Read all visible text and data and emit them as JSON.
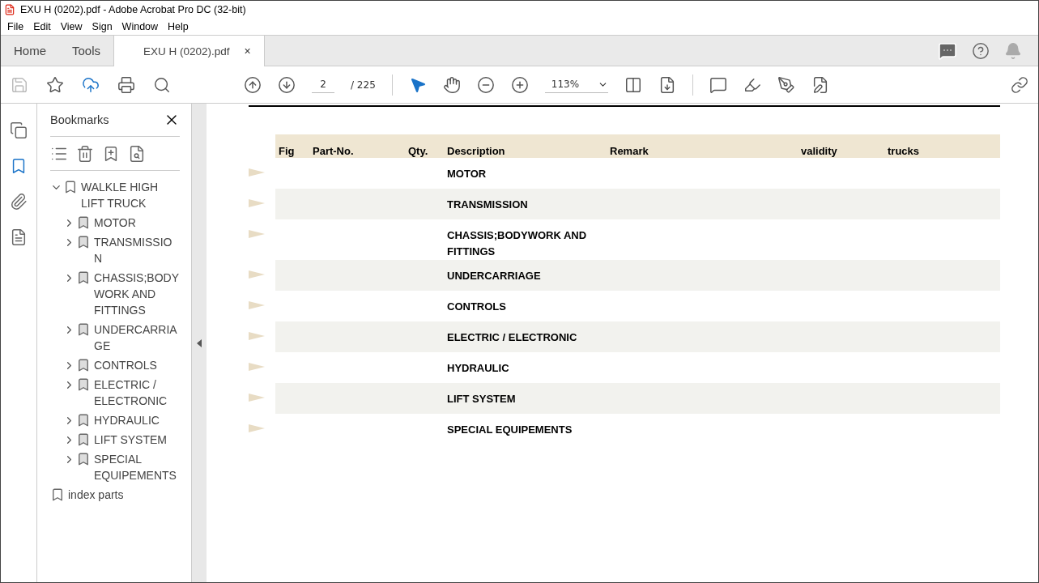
{
  "window": {
    "title": "EXU H (0202).pdf - Adobe Acrobat Pro DC (32-bit)"
  },
  "menu": [
    "File",
    "Edit",
    "View",
    "Sign",
    "Window",
    "Help"
  ],
  "tabs": [
    {
      "label": "Home",
      "selected": false
    },
    {
      "label": "Tools",
      "selected": false
    },
    {
      "label": "EXU H (0202).pdf",
      "selected": true,
      "close": "×"
    }
  ],
  "toolbar": {
    "page": "2",
    "page_total": "/ 225",
    "zoom": "113%"
  },
  "bookmarks": {
    "title": "Bookmarks",
    "items": [
      {
        "label": "WALKLE HIGH LIFT TRUCK",
        "expanded": true,
        "children": [
          {
            "label": "MOTOR",
            "expanded": false
          },
          {
            "label": "TRANSMISSION",
            "expanded": false
          },
          {
            "label": "CHASSIS;BODY WORK AND FITTINGS",
            "expanded": false
          },
          {
            "label": "UNDERCARRIAGE",
            "expanded": false
          },
          {
            "label": "CONTROLS",
            "expanded": false
          },
          {
            "label": "ELECTRIC / ELECTRONIC",
            "expanded": false
          },
          {
            "label": "HYDRAULIC",
            "expanded": false
          },
          {
            "label": "LIFT SYSTEM",
            "expanded": false
          },
          {
            "label": "SPECIAL EQUIPEMENTS",
            "expanded": false
          }
        ]
      },
      {
        "label": "index parts"
      }
    ]
  },
  "table": {
    "columns": [
      "Fig",
      "Part-No.",
      "Qty.",
      "Description",
      "Remark",
      "validity",
      "trucks"
    ],
    "rows": [
      {
        "description": "MOTOR"
      },
      {
        "description": "TRANSMISSION"
      },
      {
        "description": "CHASSIS;BODYWORK AND FITTINGS"
      },
      {
        "description": "UNDERCARRIAGE"
      },
      {
        "description": "CONTROLS"
      },
      {
        "description": "ELECTRIC / ELECTRONIC"
      },
      {
        "description": "HYDRAULIC"
      },
      {
        "description": "LIFT SYSTEM"
      },
      {
        "description": "SPECIAL EQUIPEMENTS"
      }
    ]
  }
}
